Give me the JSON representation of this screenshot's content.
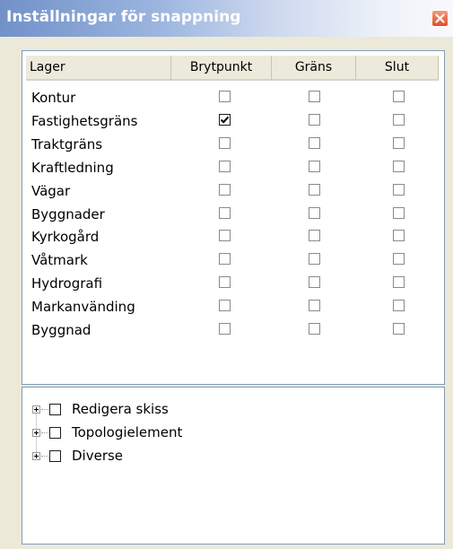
{
  "window": {
    "title": "Inställningar för snappning"
  },
  "table": {
    "columns": [
      "Lager",
      "Brytpunkt",
      "Gräns",
      "Slut"
    ],
    "rows": [
      {
        "name": "Kontur",
        "brytpunkt": false,
        "grans": false,
        "slut": false
      },
      {
        "name": "Fastighetsgräns",
        "brytpunkt": true,
        "grans": false,
        "slut": false
      },
      {
        "name": "Traktgräns",
        "brytpunkt": false,
        "grans": false,
        "slut": false
      },
      {
        "name": "Kraftledning",
        "brytpunkt": false,
        "grans": false,
        "slut": false
      },
      {
        "name": "Vägar",
        "brytpunkt": false,
        "grans": false,
        "slut": false
      },
      {
        "name": "Byggnader",
        "brytpunkt": false,
        "grans": false,
        "slut": false
      },
      {
        "name": "Kyrkogård",
        "brytpunkt": false,
        "grans": false,
        "slut": false
      },
      {
        "name": "Våtmark",
        "brytpunkt": false,
        "grans": false,
        "slut": false
      },
      {
        "name": "Hydrografi",
        "brytpunkt": false,
        "grans": false,
        "slut": false
      },
      {
        "name": "Markanvänding",
        "brytpunkt": false,
        "grans": false,
        "slut": false
      },
      {
        "name": "Byggnad",
        "brytpunkt": false,
        "grans": false,
        "slut": false
      }
    ]
  },
  "tree": {
    "items": [
      {
        "label": "Redigera skiss",
        "checked": false
      },
      {
        "label": "Topologielement",
        "checked": false
      },
      {
        "label": "Diverse",
        "checked": false
      }
    ]
  }
}
